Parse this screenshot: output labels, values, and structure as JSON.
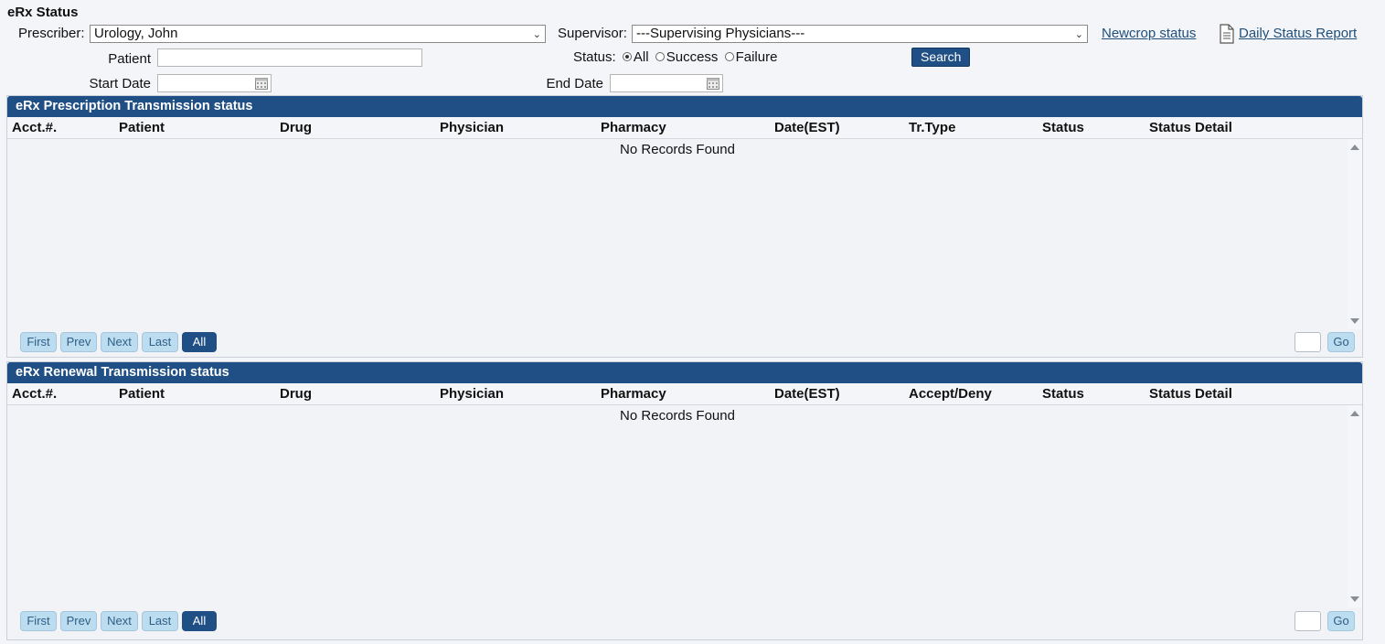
{
  "page": {
    "title": "eRx Status"
  },
  "filters": {
    "prescriber_label": "Prescriber:",
    "prescriber_value": "Urology, John",
    "supervisor_label": "Supervisor:",
    "supervisor_value": "---Supervising Physicians---",
    "newcrop_link": "Newcrop status",
    "daily_report_link": "Daily Status Report",
    "patient_label": "Patient",
    "status_label": "Status:",
    "status_options": [
      "All",
      "Success",
      "Failure"
    ],
    "status_selected": "All",
    "search_button": "Search",
    "start_date_label": "Start Date",
    "end_date_label": "End Date"
  },
  "prescription_panel": {
    "title": "eRx Prescription Transmission status",
    "columns": [
      "Acct.#.",
      "Patient",
      "Drug",
      "Physician",
      "Pharmacy",
      "Date(EST)",
      "Tr.Type",
      "Status",
      "Status Detail"
    ],
    "empty_text": "No Records Found",
    "pager": {
      "first": "First",
      "prev": "Prev",
      "next": "Next",
      "last": "Last",
      "all": "All",
      "go": "Go"
    }
  },
  "renewal_panel": {
    "title": "eRx Renewal Transmission status",
    "columns": [
      "Acct.#.",
      "Patient",
      "Drug",
      "Physician",
      "Pharmacy",
      "Date(EST)",
      "Accept/Deny",
      "Status",
      "Status Detail"
    ],
    "empty_text": "No Records Found",
    "pager": {
      "first": "First",
      "prev": "Prev",
      "next": "Next",
      "last": "Last",
      "all": "All",
      "go": "Go"
    }
  },
  "colors": {
    "header_blue": "#1f4f84",
    "pager_button": "#bcdcf0",
    "link": "#1f4f7a"
  }
}
